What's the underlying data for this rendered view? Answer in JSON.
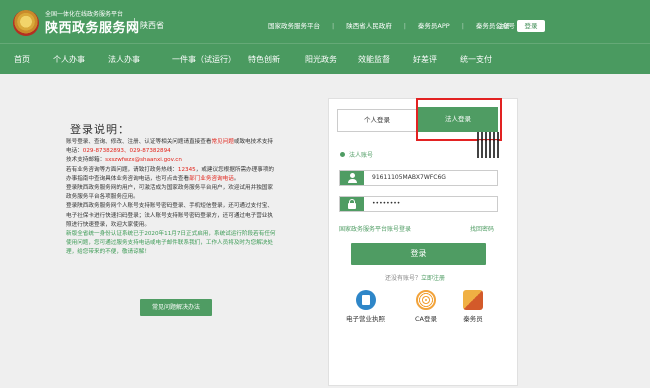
{
  "header": {
    "logo_small": "全国一体化在线政务服务平台",
    "logo_big": "陕西政务服务网",
    "region": "陕西省",
    "links": [
      "国家政务服务平台",
      "陕西省人民政府",
      "秦务员APP",
      "秦务员公众号"
    ],
    "register": "注册",
    "login": "登录"
  },
  "nav": [
    "首页",
    "个人办事",
    "法人办事",
    "一件事（试运行）",
    "特色创新",
    "阳光政务",
    "效能监督",
    "好差评",
    "统一支付"
  ],
  "info": {
    "title": "登录说明：",
    "p1_a": "账号登录、查询、修改、注册、认证等相关问题请直接查看",
    "p1_link": "常见问题",
    "p1_b": "或",
    "p1_c": "致电技术支持电话：",
    "p1_phone": "029-87382893、029-87382894",
    "p2_a": "技术支持邮箱：",
    "p2_email": "sxszwfwzx@shaanxi.gov.cn",
    "p3_a": "若有业务咨询等方面问题，请致打政务热线：",
    "p3_hotline": "12345",
    "p3_b": "，或建议您根据所需办理事项的办事指南中查询具体业务咨询电话，也可点击查看",
    "p3_link": "部门业务咨询电话",
    "p3_c": "。",
    "p4": "登录陕西政务服务网的用户，可激活成为国家政务服务平台用户，欢迎试用并独国家政务服务平台各项服务应用。",
    "p5": "登录陕西政务服务网个人账号支持账号密码登录、手机短信登录，还可通过支付宝、电子社保卡进行快速扫码登录；法人账号支持账号密码登录方，还可通过电子营业执照进行快速登录，欢迎大家使用。",
    "p6": "新版全省统一身份认证系统已于2020年11月7日正式启用，系统试运行阶段若有任何使用问题，您可通过服务支持电话或电子邮件联系我们，工作人员将及时为您解决处理，给您带来的不便，敬请谅解！",
    "faq_button": "常见问题解决办法"
  },
  "login": {
    "tab_personal": "个人登录",
    "tab_legal": "法人登录",
    "account_label": "法人账号",
    "account_value": "91611105MABX7WFC6G",
    "password_value": "••••••••",
    "forgot_link": "国家政务服务平台账号登录",
    "retrieve_link": "找回密码",
    "submit": "登录",
    "no_account": "还没有账号？",
    "register_now": "立即注册",
    "ext": [
      {
        "label": "电子营业执照",
        "icon": "business-license-icon"
      },
      {
        "label": "CA登录",
        "icon": "ca-fingerprint-icon"
      },
      {
        "label": "秦务员",
        "icon": "qinwuyuan-app-icon"
      }
    ]
  },
  "colors": {
    "brand_green": "#4a9a60",
    "highlight_red": "#e22222"
  }
}
